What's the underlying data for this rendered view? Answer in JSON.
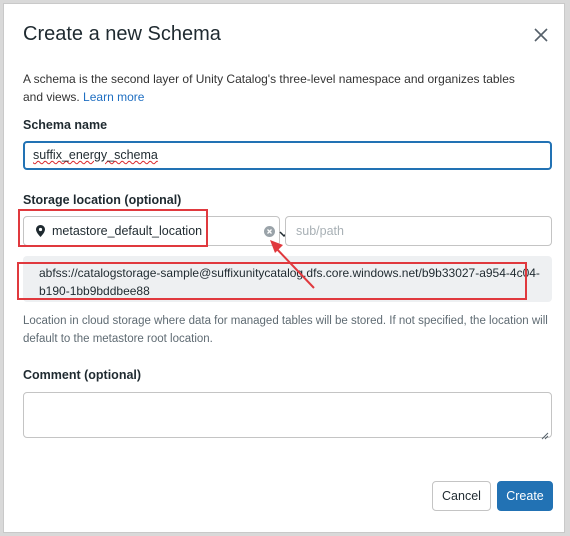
{
  "dialog": {
    "title": "Create a new Schema",
    "description": "A schema is the second layer of Unity Catalog's three-level namespace and organizes tables and views.",
    "learn_more": "Learn more"
  },
  "schema_name": {
    "label": "Schema name",
    "value": "suffix_energy_schema"
  },
  "storage": {
    "label": "Storage location (optional)",
    "selected": "metastore_default_location",
    "subpath_placeholder": "sub/path",
    "resolved_path": "abfss://catalogstorage-sample@suffixunitycatalog.dfs.core.windows.net/b9b33027-a954-4c04-b190-1bb9bddbee88",
    "hint": "Location in cloud storage where data for managed tables will be stored. If not specified, the location will default to the metastore root location."
  },
  "comment": {
    "label": "Comment (optional)",
    "value": ""
  },
  "buttons": {
    "cancel": "Cancel",
    "create": "Create"
  },
  "annotation_color": "#e0393e",
  "accent_color": "#2272b4",
  "icons": [
    "close-icon",
    "location-pin-icon",
    "clear-icon",
    "chevron-down-icon",
    "resize-handle-icon"
  ]
}
